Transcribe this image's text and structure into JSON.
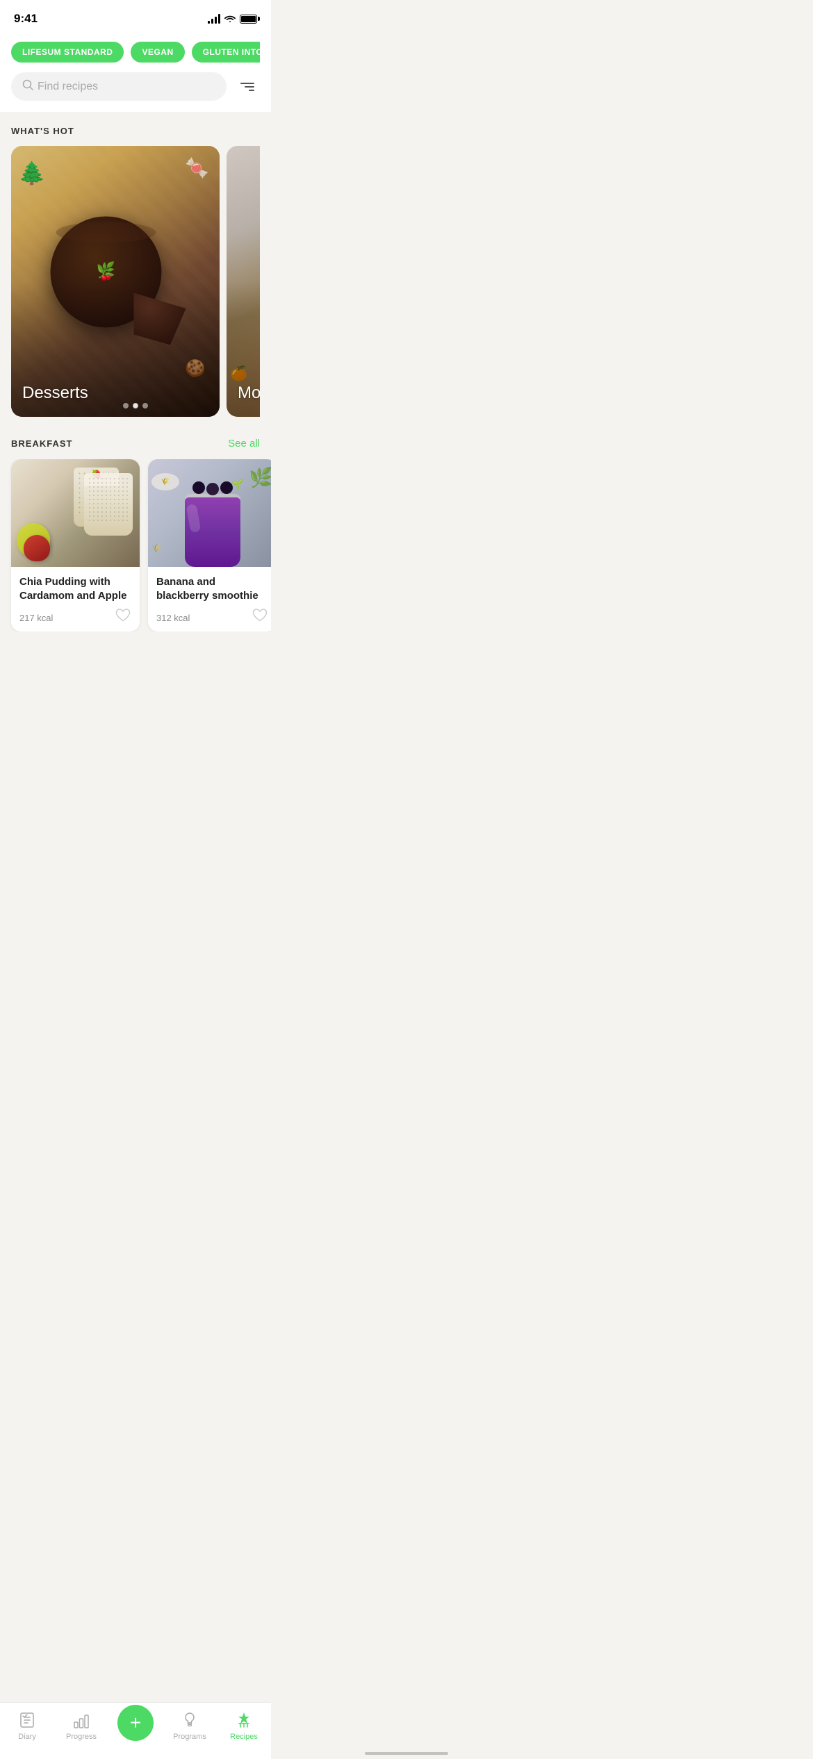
{
  "statusBar": {
    "time": "9:41"
  },
  "planTags": [
    {
      "label": "LIFESUM STANDARD"
    },
    {
      "label": "VEGAN"
    },
    {
      "label": "GLUTEN INTO..."
    }
  ],
  "search": {
    "placeholder": "Find recipes"
  },
  "sections": {
    "whatsHot": {
      "title": "WHAT'S HOT",
      "cards": [
        {
          "label": "Desserts"
        },
        {
          "label": "Mock..."
        }
      ]
    },
    "breakfast": {
      "title": "BREAKFAST",
      "seeAll": "See all",
      "recipes": [
        {
          "name": "Chia Pudding with Cardamom and Apple",
          "kcal": "217 kcal"
        },
        {
          "name": "Banana and blackberry smoothie",
          "kcal": "312 kcal"
        }
      ]
    }
  },
  "bottomNav": {
    "items": [
      {
        "label": "Diary",
        "active": false
      },
      {
        "label": "Progress",
        "active": false
      },
      {
        "label": "",
        "isAdd": true
      },
      {
        "label": "Programs",
        "active": false
      },
      {
        "label": "Recipes",
        "active": true
      }
    ]
  },
  "colors": {
    "green": "#4cd964",
    "activeNav": "#4cd964",
    "inactiveNav": "#aaa"
  }
}
